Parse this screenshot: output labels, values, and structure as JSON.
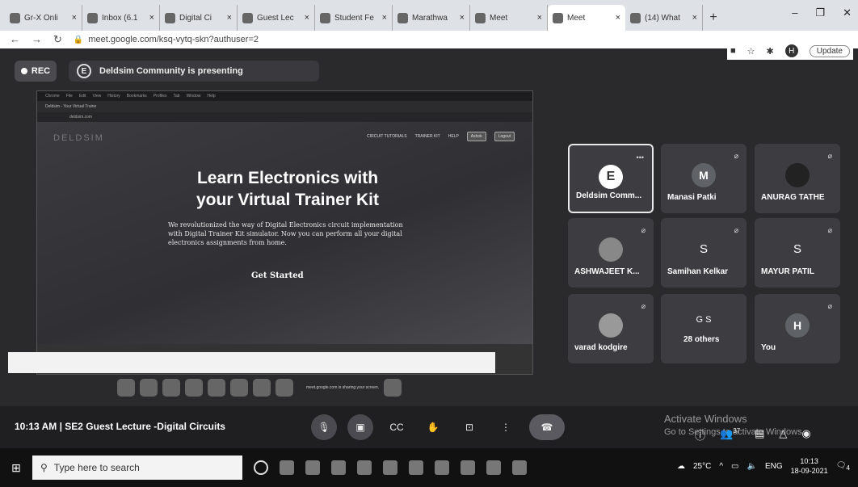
{
  "browser": {
    "tabs": [
      {
        "label": "Gr-X Onli",
        "icon": "gmail-icon"
      },
      {
        "label": "Inbox (6.1",
        "icon": "gmail-icon"
      },
      {
        "label": "Digital Ci",
        "icon": "drive-icon"
      },
      {
        "label": "Guest Lec",
        "icon": "doc-icon"
      },
      {
        "label": "Student Fe",
        "icon": "doc-icon"
      },
      {
        "label": "Marathwa",
        "icon": "doc-icon"
      },
      {
        "label": "Meet",
        "icon": "meet-icon"
      },
      {
        "label": "Meet",
        "icon": "meet-icon",
        "active": true
      },
      {
        "label": "(14) What",
        "icon": "whatsapp-icon"
      }
    ],
    "new_tab": "+",
    "url": "meet.google.com/ksq-vytq-skn?authuser=2",
    "update_label": "Update",
    "profile_initial": "H"
  },
  "meet": {
    "rec_label": "REC",
    "presenting_label": "Deldsim Community is presenting",
    "shared_screen": {
      "menu": [
        "Chrome",
        "File",
        "Edit",
        "View",
        "History",
        "Bookmarks",
        "Profiles",
        "Tab",
        "Window",
        "Help"
      ],
      "tab_title": "Deldsim - Your Virtual Traine",
      "address": "deldsim.com",
      "site_logo": "DELDSIM",
      "nav": [
        "CIRCUIT TUTORIALS",
        "TRAINER KIT",
        "HELP",
        "Ashok",
        "Logout"
      ],
      "title_line1": "Learn Electronics with",
      "title_line2": "your Virtual Trainer Kit",
      "description": "We revolutionized the way of Digital Electronics circuit implementation with Digital Trainer Kit simulator. Now you can perform all your digital electronics assignments from home.",
      "cta": "Get Started",
      "share_notice": "meet.google.com is sharing your screen."
    },
    "participants": [
      {
        "name": "Deldsim Comm...",
        "avatar": "E",
        "muted": false
      },
      {
        "name": "Manasi Patki",
        "avatar": "M",
        "muted": true
      },
      {
        "name": "ANURAG TATHE",
        "avatar": "",
        "muted": true
      },
      {
        "name": "ASHWAJEET K...",
        "avatar": "",
        "muted": true
      },
      {
        "name": "Samihan Kelkar",
        "avatar": "S",
        "muted": true
      },
      {
        "name": "MAYUR PATIL",
        "avatar": "S",
        "muted": true
      },
      {
        "name": "varad kodgire",
        "avatar": "",
        "muted": true
      },
      {
        "name": "28 others",
        "avatar": "G S",
        "muted": false
      },
      {
        "name": "You",
        "avatar": "H",
        "muted": true
      }
    ],
    "meeting_info": "10:13 AM  |  SE2 Guest Lecture -Digital Circuits",
    "activate_title": "Activate Windows",
    "activate_sub": "Go to Settings to activate Windows.",
    "people_count": "37"
  },
  "taskbar": {
    "search_placeholder": "Type here to search",
    "weather": "25°C",
    "lang": "ENG",
    "time": "10:13",
    "date": "18-09-2021",
    "notif_count": "4"
  }
}
